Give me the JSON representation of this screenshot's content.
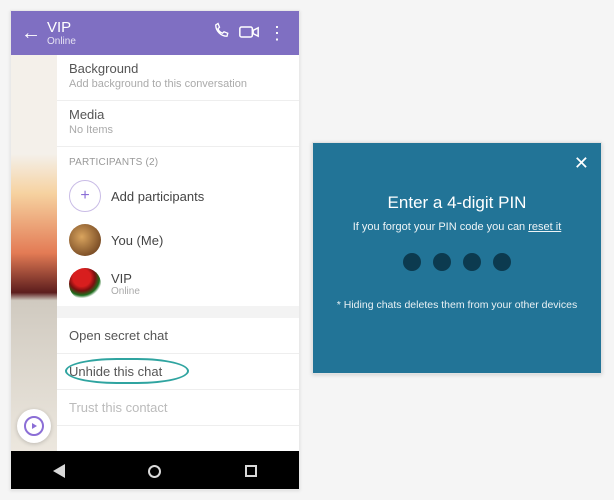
{
  "phone": {
    "header": {
      "name": "VIP",
      "status": "Online"
    },
    "background": {
      "label": "Background",
      "sub": "Add background to this conversation"
    },
    "media": {
      "label": "Media",
      "sub": "No Items"
    },
    "participants_title": "PARTICIPANTS (2)",
    "add_label": "Add participants",
    "participants": [
      {
        "name": "You (Me)",
        "status": ""
      },
      {
        "name": "VIP",
        "status": "Online"
      }
    ],
    "rows": {
      "secret": "Open secret chat",
      "unhide": "Unhide this chat",
      "trust": "Trust this contact"
    }
  },
  "dialog": {
    "title": "Enter a 4-digit PIN",
    "sub_prefix": "If you forgot your PIN code you can ",
    "reset_link": "reset it",
    "note": "* Hiding chats deletes them from your other devices"
  }
}
